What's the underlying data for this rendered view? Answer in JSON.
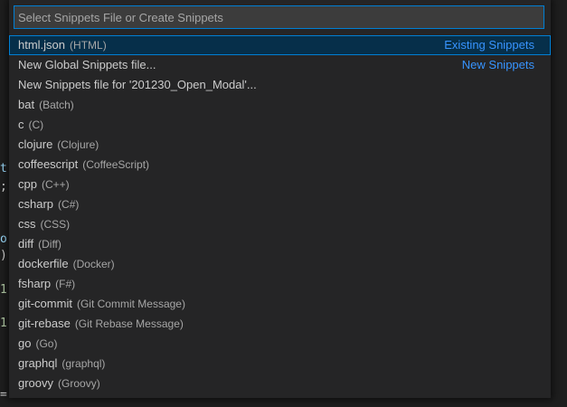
{
  "editor": {
    "fragments": [
      {
        "text": "t)",
        "color": "#9cdcfe"
      },
      {
        "text": ";",
        "color": "#d4d4d4"
      },
      {
        "text": "or",
        "color": "#9cdcfe"
      },
      {
        "text": ")-",
        "color": "#d4d4d4"
      },
      {
        "text": "1",
        "color": "#b5cea8"
      },
      {
        "text": "1",
        "color": "#b5cea8"
      },
      {
        "text": "=",
        "color": "#d4d4d4"
      }
    ]
  },
  "quick_pick": {
    "placeholder": "Select Snippets File or Create Snippets",
    "value": "",
    "items": [
      {
        "label": "html.json",
        "description": "(HTML)",
        "separator": "Existing Snippets",
        "selected": true
      },
      {
        "label": "New Global Snippets file...",
        "description": "",
        "separator": "New Snippets",
        "selected": false
      },
      {
        "label": "New Snippets file for '201230_Open_Modal'...",
        "description": "",
        "separator": "",
        "selected": false
      },
      {
        "label": "bat",
        "description": "(Batch)",
        "separator": "",
        "selected": false
      },
      {
        "label": "c",
        "description": "(C)",
        "separator": "",
        "selected": false
      },
      {
        "label": "clojure",
        "description": "(Clojure)",
        "separator": "",
        "selected": false
      },
      {
        "label": "coffeescript",
        "description": "(CoffeeScript)",
        "separator": "",
        "selected": false
      },
      {
        "label": "cpp",
        "description": "(C++)",
        "separator": "",
        "selected": false
      },
      {
        "label": "csharp",
        "description": "(C#)",
        "separator": "",
        "selected": false
      },
      {
        "label": "css",
        "description": "(CSS)",
        "separator": "",
        "selected": false
      },
      {
        "label": "diff",
        "description": "(Diff)",
        "separator": "",
        "selected": false
      },
      {
        "label": "dockerfile",
        "description": "(Docker)",
        "separator": "",
        "selected": false
      },
      {
        "label": "fsharp",
        "description": "(F#)",
        "separator": "",
        "selected": false
      },
      {
        "label": "git-commit",
        "description": "(Git Commit Message)",
        "separator": "",
        "selected": false
      },
      {
        "label": "git-rebase",
        "description": "(Git Rebase Message)",
        "separator": "",
        "selected": false
      },
      {
        "label": "go",
        "description": "(Go)",
        "separator": "",
        "selected": false
      },
      {
        "label": "graphql",
        "description": "(graphql)",
        "separator": "",
        "selected": false
      },
      {
        "label": "groovy",
        "description": "(Groovy)",
        "separator": "",
        "selected": false
      }
    ]
  },
  "colors": {
    "accent": "#007fd4",
    "separator_label": "#3794ff",
    "selected_bg": "#062f4a",
    "widget_bg": "#252526"
  }
}
